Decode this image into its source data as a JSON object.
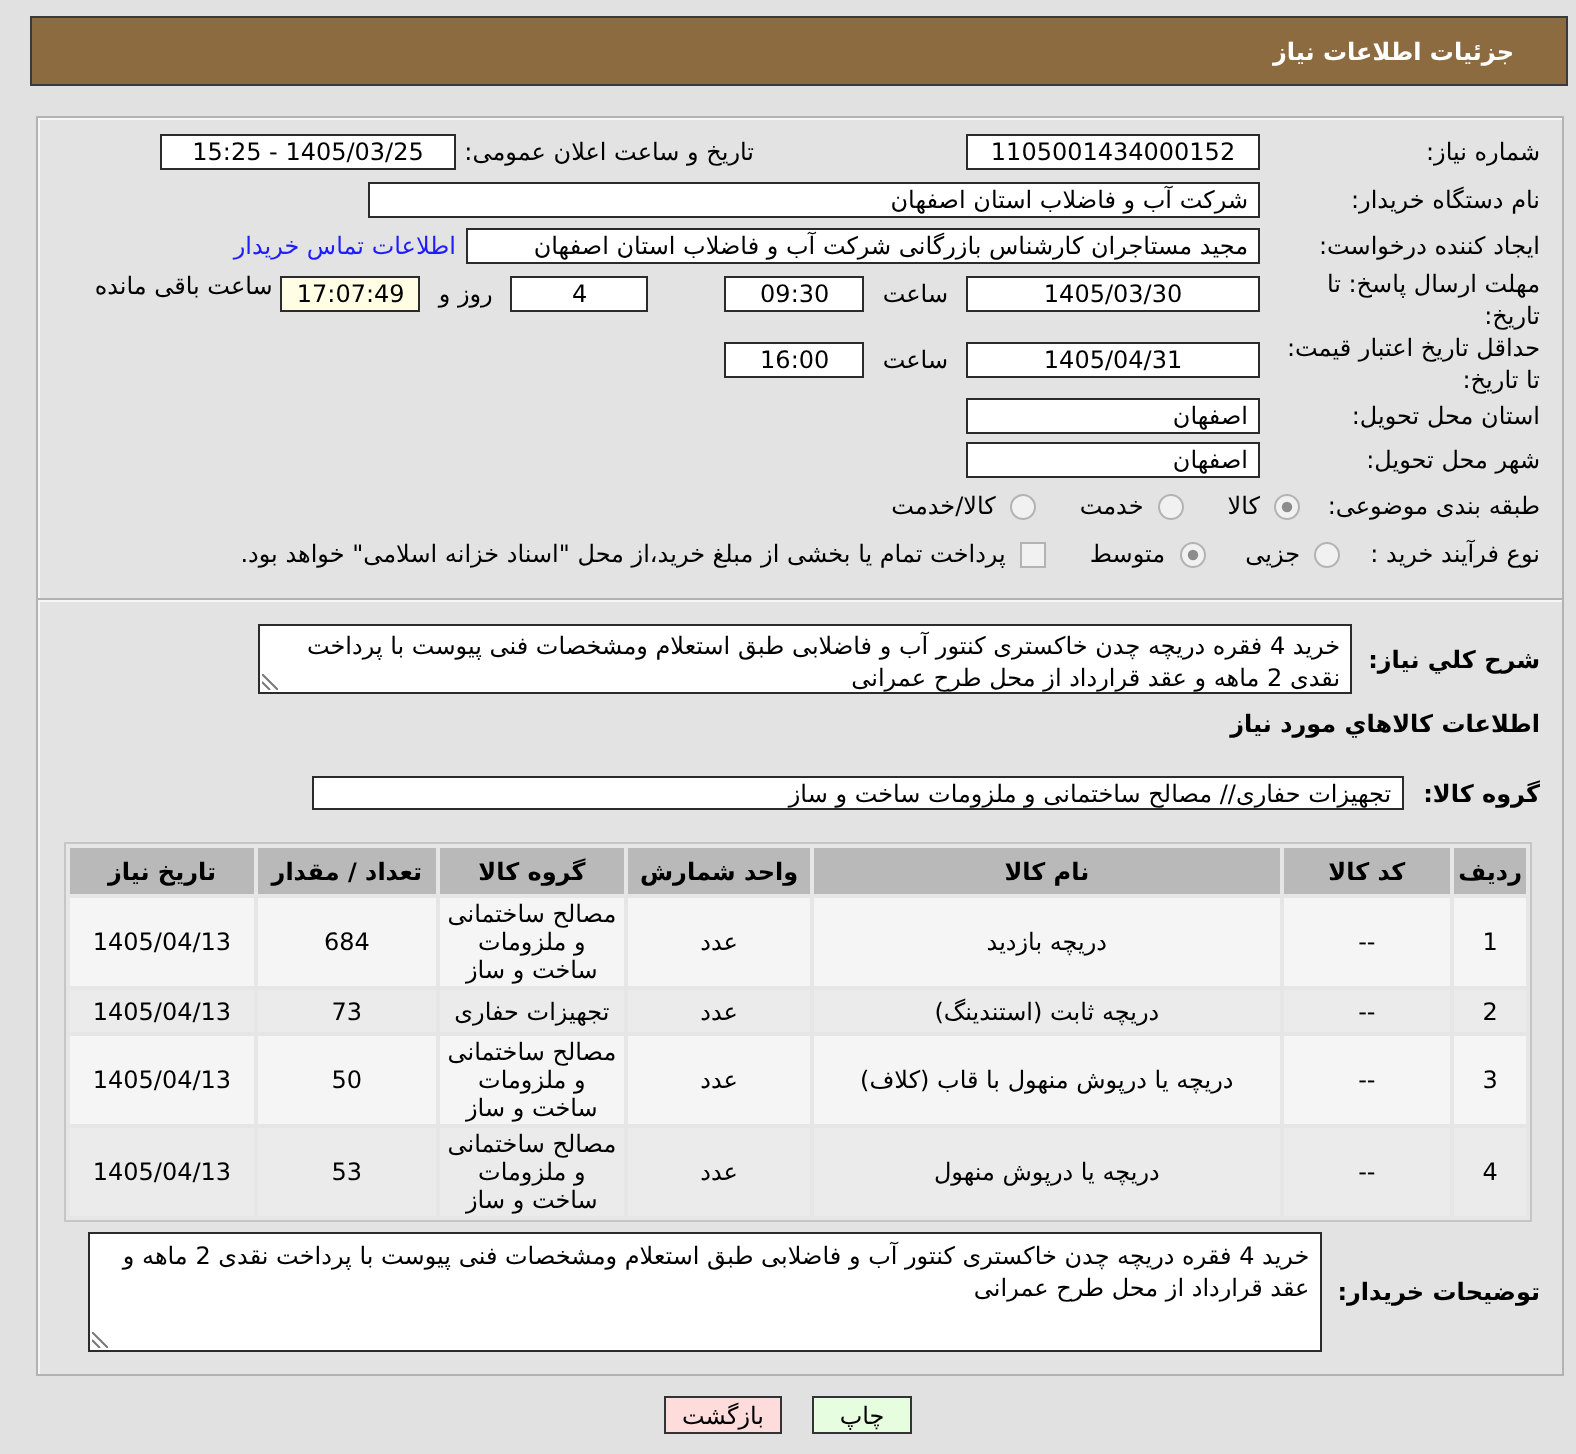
{
  "header": {
    "title": "جزئیات اطلاعات نیاز"
  },
  "details": {
    "need_number": {
      "label": "شماره نیاز:",
      "value": "1105001434000152"
    },
    "announce_date": {
      "label": "تاریخ و ساعت اعلان عمومی:",
      "value": "1405/03/25 - 15:25"
    },
    "buyer": {
      "label": "نام دستگاه خریدار:",
      "value": "شرکت آب و فاضلاب استان اصفهان"
    },
    "requester": {
      "label": "ایجاد کننده درخواست:",
      "value": "مجید مستاجران کارشناس بازرگانی شرکت آب و فاضلاب استان اصفهان",
      "contact_link": "اطلاعات تماس خریدار"
    },
    "reply_deadline": {
      "label": "مهلت ارسال پاسخ: تا تاریخ:",
      "date": "1405/03/30",
      "time_label": "ساعت",
      "time": "09:30",
      "days": "4",
      "days_label": "روز و",
      "remaining": "17:07:49",
      "remaining_label": "ساعت باقی مانده"
    },
    "price_validity": {
      "label": "حداقل تاریخ اعتبار قیمت: تا تاریخ:",
      "date": "1405/04/31",
      "time_label": "ساعت",
      "time": "16:00"
    },
    "delivery_province": {
      "label": "استان محل تحویل:",
      "value": "اصفهان"
    },
    "delivery_city": {
      "label": "شهر محل تحویل:",
      "value": "اصفهان"
    },
    "category": {
      "label": "طبقه بندی موضوعی:",
      "options": [
        {
          "label": "کالا",
          "selected": true
        },
        {
          "label": "خدمت",
          "selected": false
        },
        {
          "label": "کالا/خدمت",
          "selected": false
        }
      ]
    },
    "process_type": {
      "label": "نوع فرآیند خرید :",
      "options": [
        {
          "label": "جزیی",
          "selected": false
        },
        {
          "label": "متوسط",
          "selected": true
        }
      ],
      "treasury_payment": {
        "label": "پرداخت تمام یا بخشی از مبلغ خرید،از محل \"اسناد خزانه اسلامی\" خواهد بود.",
        "checked": false
      }
    }
  },
  "need_description": {
    "label": "شرح کلي نیاز:",
    "value": "خرید 4 فقره دریچه چدن خاکستری کنتور آب و فاضلابی طبق استعلام ومشخصات فنی پیوست با پرداخت نقدی 2 ماهه و عقد قرارداد از محل طرح عمرانی"
  },
  "goods": {
    "title": "اطلاعات کالاهاي مورد نیاز",
    "group": {
      "label": "گروه کالا:",
      "value": "تجهیزات حفاری// مصالح ساختمانی و ملزومات ساخت و ساز"
    },
    "table": {
      "columns": [
        "ردیف",
        "کد کالا",
        "نام کالا",
        "واحد شمارش",
        "گروه کالا",
        "تعداد / مقدار",
        "تاریخ نیاز"
      ],
      "rows": [
        [
          "1",
          "--",
          "دریچه بازدید",
          "عدد",
          "مصالح ساختمانی و ملزومات ساخت و ساز",
          "684",
          "1405/04/13"
        ],
        [
          "2",
          "--",
          "دریچه ثابت (استندینگ)",
          "عدد",
          "تجهیزات حفاری",
          "73",
          "1405/04/13"
        ],
        [
          "3",
          "--",
          "دریچه یا درپوش منهول با قاب (کلاف)",
          "عدد",
          "مصالح ساختمانی و ملزومات ساخت و ساز",
          "50",
          "1405/04/13"
        ],
        [
          "4",
          "--",
          "دریچه یا درپوش منهول",
          "عدد",
          "مصالح ساختمانی و ملزومات ساخت و ساز",
          "53",
          "1405/04/13"
        ]
      ]
    }
  },
  "buyer_notes": {
    "label": "توضیحات خریدار:",
    "value": "خرید 4 فقره دریچه چدن خاکستری کنتور آب و فاضلابی طبق استعلام ومشخصات فنی پیوست با پرداخت نقدی 2 ماهه و عقد قرارداد از محل طرح عمرانی"
  },
  "buttons": [
    {
      "label": "چاپ",
      "kind": "print"
    },
    {
      "label": "بازگشت",
      "kind": "back"
    }
  ]
}
